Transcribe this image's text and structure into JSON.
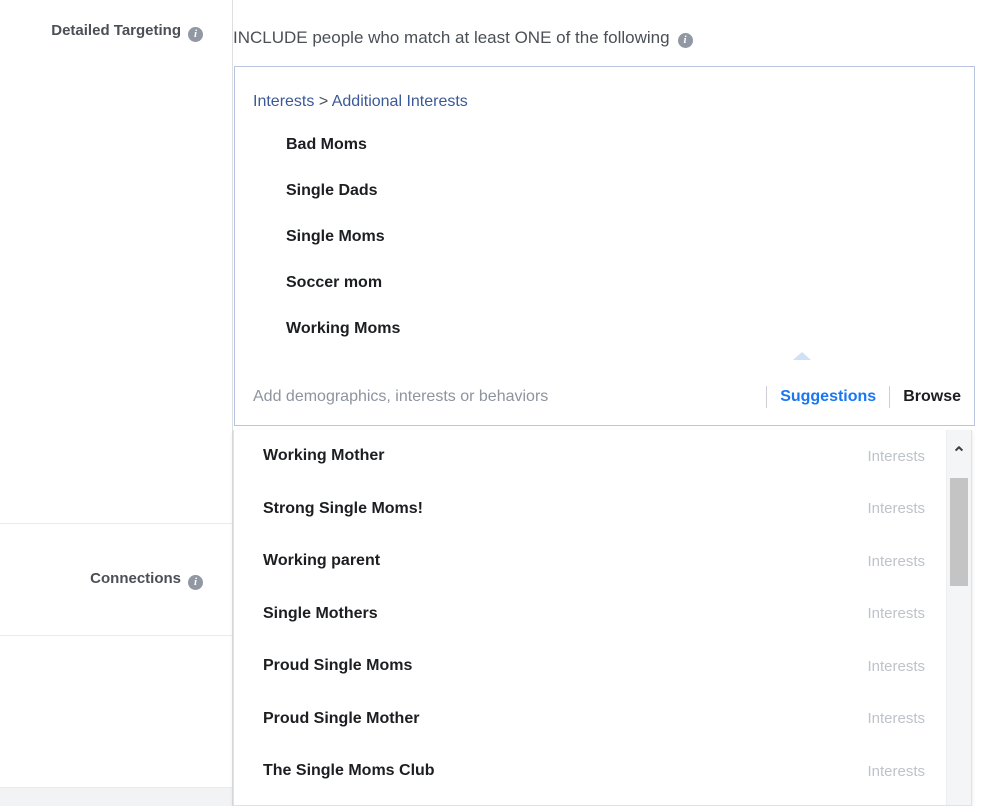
{
  "sidebar": {
    "detailed_targeting_label": "Detailed Targeting",
    "connections_label": "Connections",
    "info_glyph": "i"
  },
  "main": {
    "include_heading": "INCLUDE people who match at least ONE of the following",
    "info_glyph": "i",
    "breadcrumb": {
      "root": "Interests",
      "separator": ">",
      "child": "Additional Interests"
    },
    "selected_interests": [
      "Bad Moms",
      "Single Dads",
      "Single Moms",
      "Soccer mom",
      "Working Moms"
    ],
    "search": {
      "placeholder": "Add demographics, interests or behaviors",
      "value": ""
    },
    "tabs": {
      "suggestions_label": "Suggestions",
      "browse_label": "Browse",
      "active": "Suggestions"
    },
    "suggestions": [
      {
        "name": "Working Mother",
        "type": "Interests"
      },
      {
        "name": "Strong Single Moms!",
        "type": "Interests"
      },
      {
        "name": "Working parent",
        "type": "Interests"
      },
      {
        "name": "Single Mothers",
        "type": "Interests"
      },
      {
        "name": "Proud Single Moms",
        "type": "Interests"
      },
      {
        "name": "Proud Single Mother",
        "type": "Interests"
      },
      {
        "name": "The Single Moms Club",
        "type": "Interests"
      }
    ],
    "scrollbar": {
      "up_arrow_glyph": "⌃"
    }
  },
  "colors": {
    "link_blue": "#3b5998",
    "active_blue": "#1877f2",
    "label_gray": "#4b4f56",
    "placeholder_gray": "#8d949e",
    "type_gray": "#bec3c9",
    "box_border": "#b8c4e0"
  }
}
